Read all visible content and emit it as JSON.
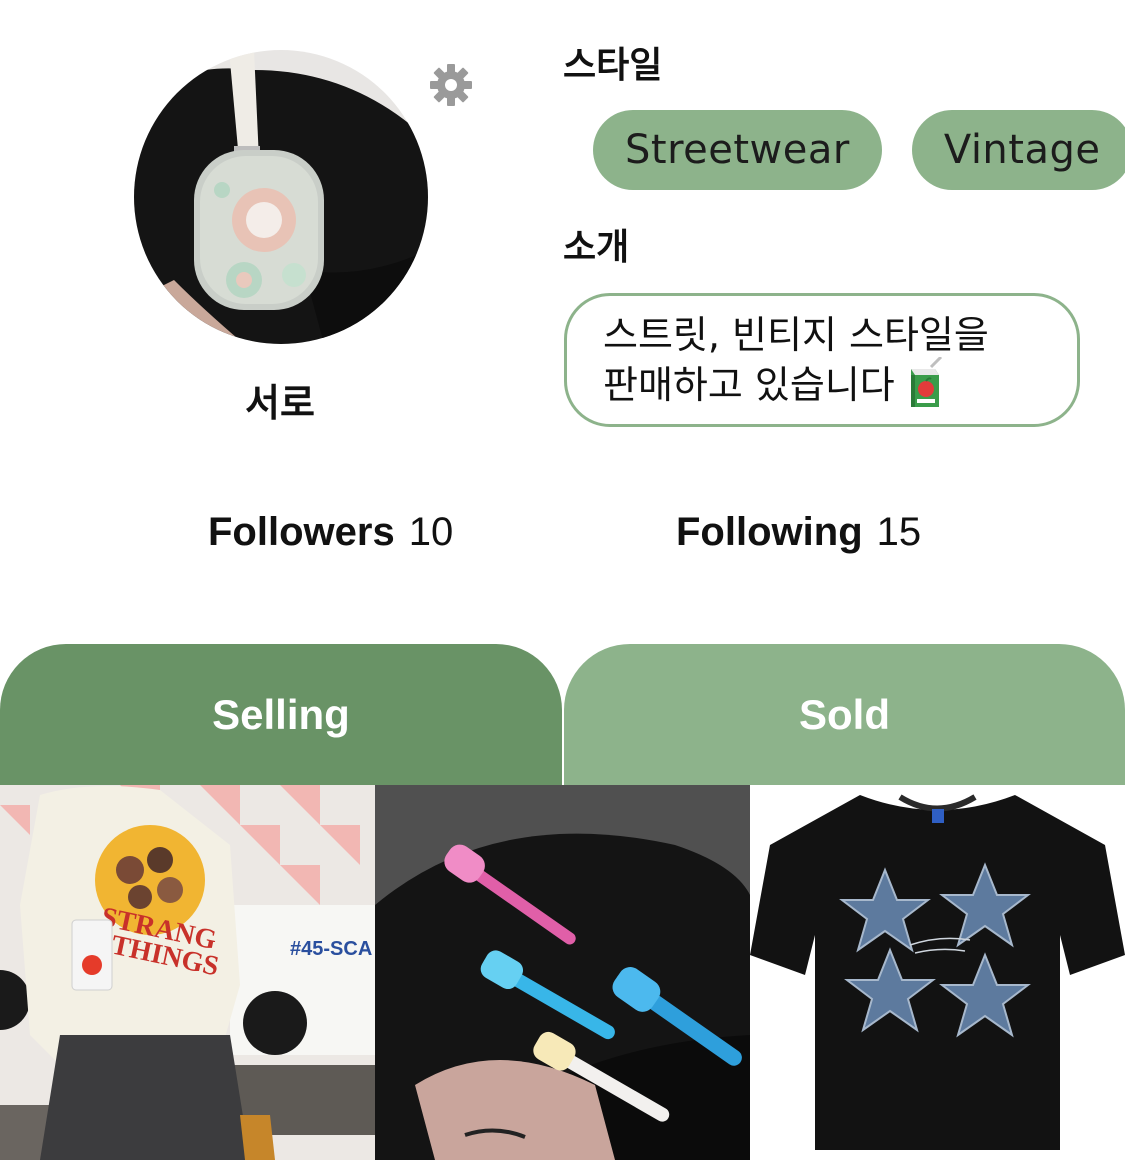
{
  "profile": {
    "username": "서로",
    "style_label": "스타일",
    "style_tags": [
      "Streetwear",
      "Vintage"
    ],
    "intro_label": "소개",
    "intro_line1": "스트릿, 빈티지 스타일을",
    "intro_line2": "판매하고 있습니다"
  },
  "stats": {
    "followers_label": "Followers",
    "followers_count": "10",
    "following_label": "Following",
    "following_count": "15"
  },
  "tabs": {
    "selling": "Selling",
    "sold": "Sold",
    "active": "selling"
  },
  "products": [
    {
      "print_text": "#45-SCA"
    },
    {},
    {}
  ],
  "icons": {
    "settings": "gear-icon",
    "intro_emoji": "juice-box-icon"
  },
  "colors": {
    "accent_dark": "#699366",
    "accent_light": "#8db38b",
    "tag_text": "#1c1c1c",
    "gear": "#9a9a9a"
  }
}
